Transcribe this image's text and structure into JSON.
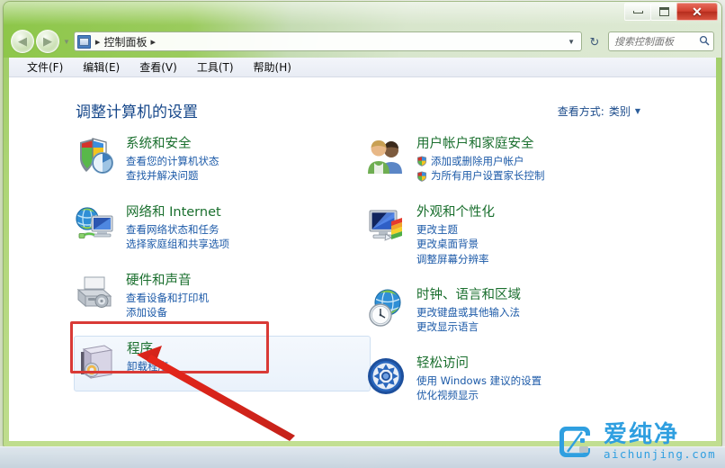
{
  "window": {
    "caption_buttons": {
      "minimize": "−",
      "maximize": "❐",
      "close": "✕"
    }
  },
  "navbar": {
    "back_arrow": "◀",
    "forward_arrow": "▶",
    "breadcrumb_icon": "control-panel-icon",
    "breadcrumb": "控制面板",
    "separator": "▸",
    "dropdown_caret": "▼",
    "refresh_glyph": "↻",
    "search": {
      "placeholder": "搜索控制面板",
      "value": "",
      "icon": "search-icon"
    }
  },
  "menubar": {
    "items": [
      {
        "label": "文件(F)"
      },
      {
        "label": "编辑(E)"
      },
      {
        "label": "查看(V)"
      },
      {
        "label": "工具(T)"
      },
      {
        "label": "帮助(H)"
      }
    ]
  },
  "content": {
    "heading": "调整计算机的设置",
    "view_by": {
      "label": "查看方式:",
      "value": "类别",
      "caret": "▼"
    }
  },
  "categories_left": [
    {
      "icon": "security-shield-icon",
      "title": "系统和安全",
      "links": [
        {
          "text": "查看您的计算机状态",
          "shield": false
        },
        {
          "text": "查找并解决问题",
          "shield": false
        }
      ]
    },
    {
      "icon": "network-globe-icon",
      "title": "网络和 Internet",
      "links": [
        {
          "text": "查看网络状态和任务",
          "shield": false
        },
        {
          "text": "选择家庭组和共享选项",
          "shield": false
        }
      ]
    },
    {
      "icon": "printer-hardware-icon",
      "title": "硬件和声音",
      "links": [
        {
          "text": "查看设备和打印机",
          "shield": false
        },
        {
          "text": "添加设备",
          "shield": false
        }
      ]
    },
    {
      "icon": "programs-box-icon",
      "title": "程序",
      "links": [
        {
          "text": "卸载程序",
          "shield": false
        }
      ],
      "highlighted": true
    }
  ],
  "categories_right": [
    {
      "icon": "user-accounts-icon",
      "title": "用户帐户和家庭安全",
      "links": [
        {
          "text": "添加或删除用户帐户",
          "shield": true
        },
        {
          "text": "为所有用户设置家长控制",
          "shield": true
        }
      ]
    },
    {
      "icon": "appearance-monitor-icon",
      "title": "外观和个性化",
      "links": [
        {
          "text": "更改主题",
          "shield": false
        },
        {
          "text": "更改桌面背景",
          "shield": false
        },
        {
          "text": "调整屏幕分辨率",
          "shield": false
        }
      ]
    },
    {
      "icon": "clock-globe-icon",
      "title": "时钟、语言和区域",
      "links": [
        {
          "text": "更改键盘或其他输入法",
          "shield": false
        },
        {
          "text": "更改显示语言",
          "shield": false
        }
      ]
    },
    {
      "icon": "ease-of-access-icon",
      "title": "轻松访问",
      "links": [
        {
          "text": "使用 Windows 建议的设置",
          "shield": false
        },
        {
          "text": "优化视频显示",
          "shield": false
        }
      ]
    }
  ],
  "annotations": {
    "highlight_box_color": "#d93a36",
    "arrow_color": "#e02b20",
    "target": "卸载程序"
  },
  "watermark": {
    "chinese": "爱纯净",
    "domain": "aichunjing.com",
    "color": "#2f9fe0"
  }
}
